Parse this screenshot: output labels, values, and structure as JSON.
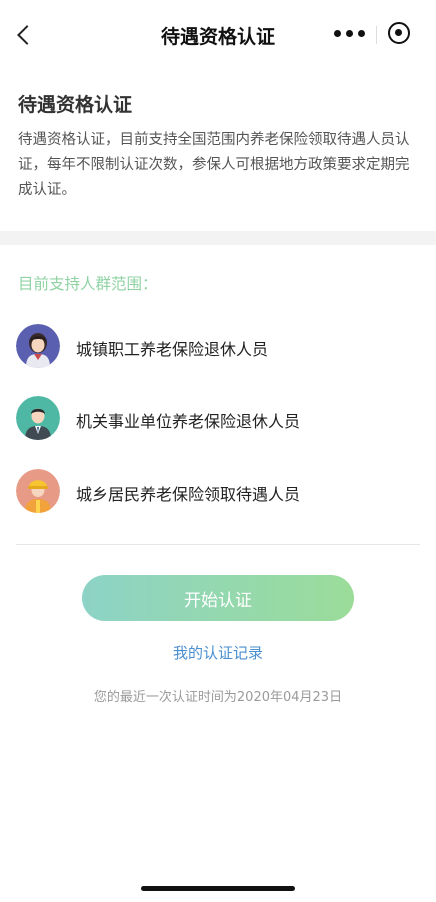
{
  "header": {
    "title": "待遇资格认证",
    "back_icon": "back-chevron-icon",
    "more_icon": "more-dots-icon",
    "close_icon": "target-icon"
  },
  "intro": {
    "title": "待遇资格认证",
    "description": "待遇资格认证，目前支持全国范围内养老保险领取待遇人员认证，每年不限制认证次数，参保人可根据地方政策要求定期完成认证。"
  },
  "group": {
    "title": "目前支持人群范围：",
    "items": [
      {
        "label": "城镇职工养老保险退休人员",
        "icon": "woman-avatar-icon",
        "color": "#5a5fb0"
      },
      {
        "label": "机关事业单位养老保险退休人员",
        "icon": "man-avatar-icon",
        "color": "#4fb8a5"
      },
      {
        "label": "城乡居民养老保险领取待遇人员",
        "icon": "worker-avatar-icon",
        "color": "#e79b86"
      }
    ]
  },
  "actions": {
    "start_label": "开始认证",
    "record_link": "我的认证记录",
    "last_time": "您的最近一次认证时间为2020年04月23日"
  },
  "colors": {
    "accent_green": "#8fd3a3",
    "link_blue": "#4a8fd0",
    "button_gradient_start": "#8dd3c6",
    "button_gradient_end": "#9bdc99"
  }
}
